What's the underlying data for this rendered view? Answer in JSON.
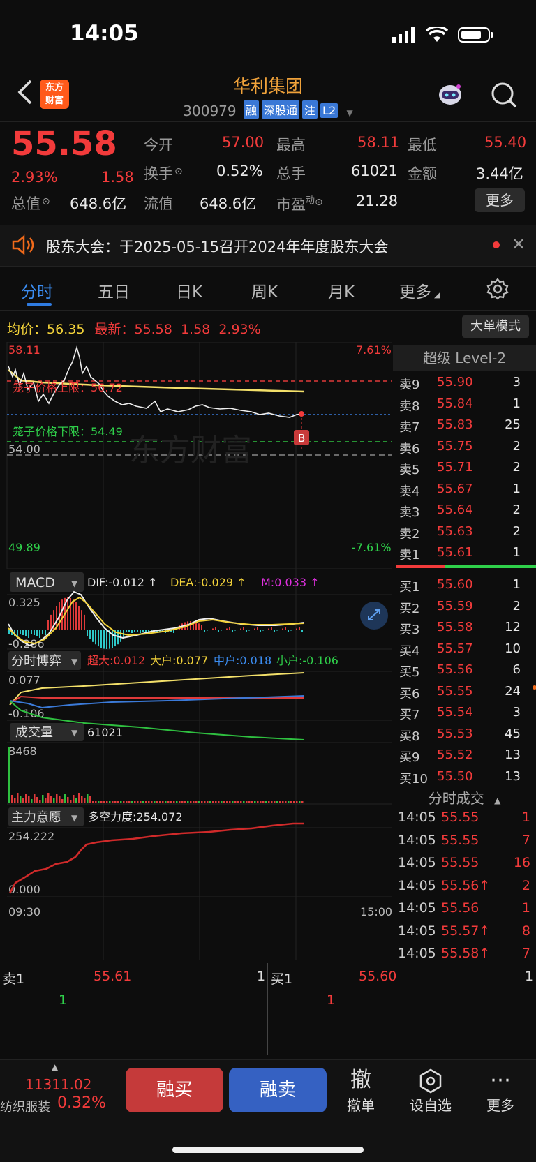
{
  "status_bar": {
    "time": "14:05"
  },
  "header": {
    "stock_name": "华利集团",
    "stock_code": "300979",
    "tags": [
      "融",
      "深股通",
      "注",
      "L2"
    ],
    "logo_text": [
      "东方",
      "财富"
    ]
  },
  "quote": {
    "price": "55.58",
    "change_pct": "2.93%",
    "change": "1.58",
    "open_label": "今开",
    "open": "57.00",
    "high_label": "最高",
    "high": "58.11",
    "low_label": "最低",
    "low": "55.40",
    "turnover_label": "换手",
    "turnover": "0.52%",
    "volume_label": "总手",
    "volume": "61021",
    "amount_label": "金额",
    "amount": "3.44亿",
    "mktcap_label": "总值",
    "mktcap": "648.6亿",
    "float_label": "流值",
    "float": "648.6亿",
    "pe_label": "市盈",
    "pe_sup": "动",
    "pe": "21.28",
    "more_label": "更多"
  },
  "notice": {
    "text": "股东大会：于2025-05-15召开2024年年度股东大会"
  },
  "tabs": [
    "分时",
    "五日",
    "日K",
    "周K",
    "月K",
    "更多"
  ],
  "info_line": {
    "avg_label": "均价：",
    "avg": "56.35",
    "latest_label": "最新：",
    "latest": "55.58",
    "chg": "1.58",
    "pct": "2.93%",
    "bigorder_label": "大单模式"
  },
  "intraday": {
    "top_left": "58.11",
    "top_right": "7.61%",
    "bottom_left": "49.89",
    "bottom_right": "-7.61%",
    "upper_cage": "笼子价格上限：56.72",
    "lower_cage": "笼子价格下限：54.49",
    "ref_price": "54.00",
    "marker": "B",
    "watermark": "东方财富"
  },
  "macd": {
    "selector": "MACD",
    "dif": "DIF:-0.012 ↑",
    "dea": "DEA:-0.029 ↑",
    "m": "M:0.033 ↑",
    "top": "0.325",
    "bottom": "-0.286"
  },
  "game": {
    "selector": "分时博弈",
    "super": "超大:0.012",
    "large": "大户:0.077",
    "mid": "中户:0.018",
    "small": "小户:-0.106",
    "top": "0.077",
    "bottom": "-0.106"
  },
  "volume": {
    "selector": "成交量",
    "value": "61021",
    "top": "8468"
  },
  "main_will": {
    "selector": "主力意愿",
    "label": "多空力度:254.072",
    "top": "254.222",
    "bottom": "0.000",
    "time_start": "09:30",
    "time_end": "15:00"
  },
  "level2": {
    "title": "超级 Level-2",
    "asks": [
      {
        "label": "卖9",
        "price": "55.90",
        "vol": "3"
      },
      {
        "label": "卖8",
        "price": "55.84",
        "vol": "1"
      },
      {
        "label": "卖7",
        "price": "55.83",
        "vol": "25"
      },
      {
        "label": "卖6",
        "price": "55.75",
        "vol": "2"
      },
      {
        "label": "卖5",
        "price": "55.71",
        "vol": "2"
      },
      {
        "label": "卖4",
        "price": "55.67",
        "vol": "1"
      },
      {
        "label": "卖3",
        "price": "55.64",
        "vol": "2"
      },
      {
        "label": "卖2",
        "price": "55.63",
        "vol": "2"
      },
      {
        "label": "卖1",
        "price": "55.61",
        "vol": "1"
      }
    ],
    "bids": [
      {
        "label": "买1",
        "price": "55.60",
        "vol": "1"
      },
      {
        "label": "买2",
        "price": "55.59",
        "vol": "2"
      },
      {
        "label": "买3",
        "price": "55.58",
        "vol": "12"
      },
      {
        "label": "买4",
        "price": "55.57",
        "vol": "10"
      },
      {
        "label": "买5",
        "price": "55.56",
        "vol": "6"
      },
      {
        "label": "买6",
        "price": "55.55",
        "vol": "24"
      },
      {
        "label": "买7",
        "price": "55.54",
        "vol": "3"
      },
      {
        "label": "买8",
        "price": "55.53",
        "vol": "45"
      },
      {
        "label": "买9",
        "price": "55.52",
        "vol": "13"
      },
      {
        "label": "买10",
        "price": "55.50",
        "vol": "13"
      }
    ]
  },
  "trades": {
    "title": "分时成交",
    "rows": [
      {
        "time": "14:05",
        "price": "55.55",
        "vol": "1"
      },
      {
        "time": "14:05",
        "price": "55.55",
        "vol": "7"
      },
      {
        "time": "14:05",
        "price": "55.55",
        "vol": "16"
      },
      {
        "time": "14:05",
        "price": "55.56↑",
        "vol": "2"
      },
      {
        "time": "14:05",
        "price": "55.56",
        "vol": "1"
      },
      {
        "time": "14:05",
        "price": "55.57↑",
        "vol": "8"
      },
      {
        "time": "14:05",
        "price": "55.58↑",
        "vol": "7"
      }
    ]
  },
  "quick_quote": {
    "ask_label": "卖1",
    "ask_price": "55.61",
    "ask_vol": "1",
    "ask_count": "1",
    "bid_label": "买1",
    "bid_price": "55.60",
    "bid_vol": "1",
    "bid_count": "1"
  },
  "bottom_bar": {
    "index_value": "11311.02",
    "index_name": "纺织服装",
    "index_pct": "0.32%",
    "buy_label": "融买",
    "sell_label": "融卖",
    "cancel_icon_text": "撤",
    "cancel_label": "撤单",
    "watch_label": "设自选",
    "more_label": "更多"
  },
  "colors": {
    "up": "#f23b3b",
    "down": "#2fd04a",
    "accent": "#2f7be0",
    "avg_line": "#f3d33a"
  }
}
